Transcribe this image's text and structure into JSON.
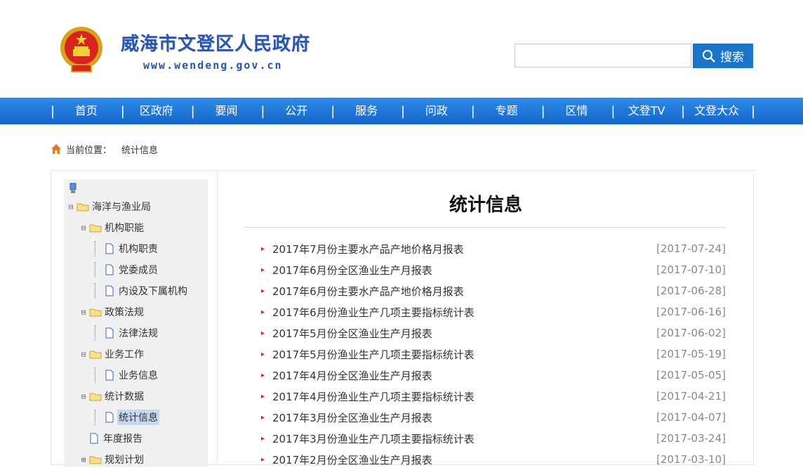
{
  "header": {
    "site_title": "威海市文登区人民政府",
    "site_url": "www.wendeng.gov.cn",
    "search_placeholder": "",
    "search_label": "搜索"
  },
  "nav": {
    "items": [
      "首页",
      "区政府",
      "要闻",
      "公开",
      "服务",
      "问政",
      "专题",
      "区情",
      "文登TV",
      "文登大众"
    ]
  },
  "breadcrumb": {
    "prefix": "当前位置：",
    "current": "统计信息"
  },
  "sidebar": {
    "root": "海洋与渔业局",
    "groups": [
      {
        "label": "机构职能",
        "children": [
          "机构职责",
          "党委成员",
          "内设及下属机构"
        ]
      },
      {
        "label": "政策法规",
        "children": [
          "法律法规"
        ]
      },
      {
        "label": "业务工作",
        "children": [
          "业务信息"
        ]
      },
      {
        "label": "统计数据",
        "children": [
          "统计信息"
        ]
      }
    ],
    "leaf": "年度报告",
    "partial": "规划计划",
    "selected": "统计信息"
  },
  "main": {
    "title": "统计信息",
    "news": [
      {
        "title": "2017年7月份主要水产品产地价格月报表",
        "date": "[2017-07-24]"
      },
      {
        "title": "2017年6月份全区渔业生产月报表",
        "date": "[2017-07-10]"
      },
      {
        "title": "2017年6月份主要水产品产地价格月报表",
        "date": "[2017-06-28]"
      },
      {
        "title": "2017年6月份渔业生产几项主要指标统计表",
        "date": "[2017-06-16]"
      },
      {
        "title": "2017年5月份全区渔业生产月报表",
        "date": "[2017-06-02]"
      },
      {
        "title": "2017年5月份渔业生产几项主要指标统计表",
        "date": "[2017-05-19]"
      },
      {
        "title": "2017年4月份全区渔业生产月报表",
        "date": "[2017-05-05]"
      },
      {
        "title": "2017年4月份渔业生产几项主要指标统计表",
        "date": "[2017-04-21]"
      },
      {
        "title": "2017年3月份全区渔业生产月报表",
        "date": "[2017-04-07]"
      },
      {
        "title": "2017年3月份渔业生产几项主要指标统计表",
        "date": "[2017-03-24]"
      },
      {
        "title": "2017年2月份全区渔业生产月报表",
        "date": "[2017-03-10]"
      }
    ]
  },
  "colors": {
    "brand_blue": "#2a55a8",
    "nav_blue": "#1a74c8",
    "bullet_red": "#c62828"
  }
}
